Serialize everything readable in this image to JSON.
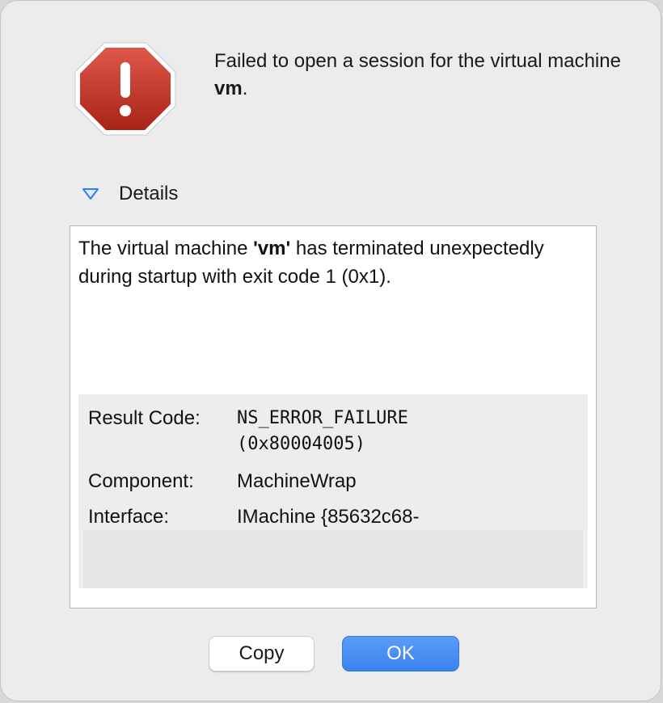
{
  "dialog": {
    "icon": "stop-alert-icon",
    "message_prefix": "Failed to open a session for the virtual machine ",
    "message_vm": "vm",
    "message_suffix": "."
  },
  "details": {
    "toggle_icon": "disclosure-triangle-down-icon",
    "label": "Details",
    "text_prefix": "The virtual machine ",
    "text_vm": "'vm'",
    "text_suffix": " has terminated unexpectedly during startup with exit code 1 (0x1).",
    "info": {
      "result_code_label": "Result Code:",
      "result_code_value_1": "NS_ERROR_FAILURE",
      "result_code_value_2": "(0x80004005)",
      "component_label": "Component:",
      "component_value": "MachineWrap",
      "interface_label": "Interface:",
      "interface_value": "IMachine {85632c68-"
    }
  },
  "buttons": {
    "copy_label": "Copy",
    "ok_label": "OK"
  },
  "colors": {
    "accent": "#3a82ee",
    "alert_red": "#c0392b"
  }
}
